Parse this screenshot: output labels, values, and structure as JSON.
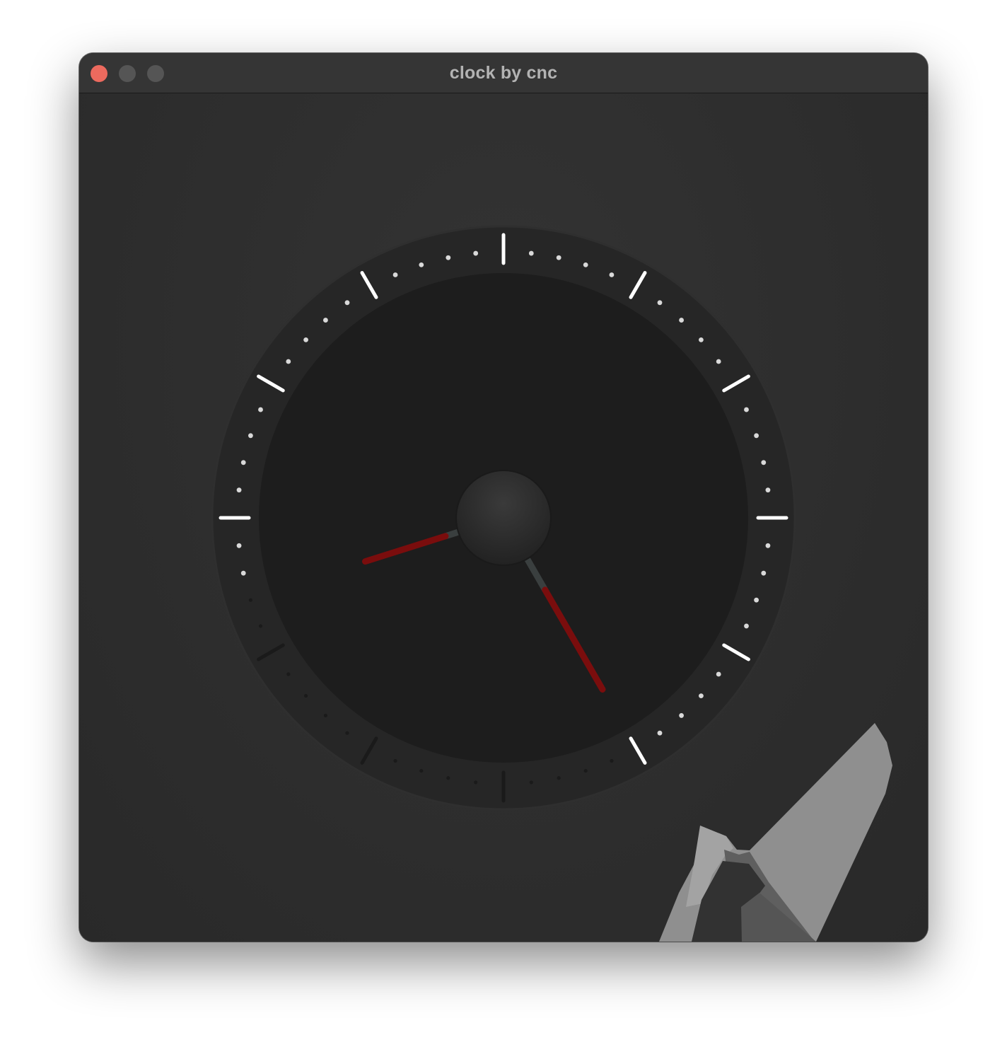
{
  "window": {
    "title": "clock by cnc",
    "controls": {
      "close": "close-button",
      "minimize": "minimize-button",
      "zoom": "zoom-button"
    }
  },
  "clock": {
    "time": {
      "hours": 8,
      "minutes": 25
    },
    "hand_color": "#7a0d0d",
    "marker_color": "#ffffff",
    "face_color": "#1d1d1d",
    "bezel_color": "#262626"
  },
  "illustration": {
    "icon": "suit-collar-tie-icon"
  }
}
